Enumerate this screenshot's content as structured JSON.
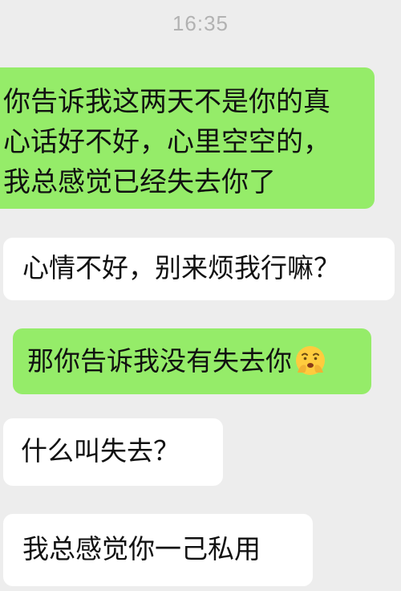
{
  "chat": {
    "timestamp": "16:35",
    "messages": [
      {
        "side": "sent",
        "lines": [
          "你告诉我这两天不是你的真",
          "心话好不好，心里空空的，",
          "我总感觉已经失去你了"
        ]
      },
      {
        "side": "received",
        "text": "心情不好，别来烦我行嘛？"
      },
      {
        "side": "sent",
        "text": "那你告诉我没有失去你",
        "emoji": "anxious-face-with-hands-icon"
      },
      {
        "side": "received",
        "text": "什么叫失去？"
      },
      {
        "side": "received",
        "text": "我总感觉你一己私用"
      }
    ]
  },
  "colors": {
    "background": "#ededed",
    "sent_bubble": "#95ec69",
    "received_bubble": "#ffffff",
    "timestamp_text": "#b2b2b2",
    "message_text": "#111111"
  }
}
